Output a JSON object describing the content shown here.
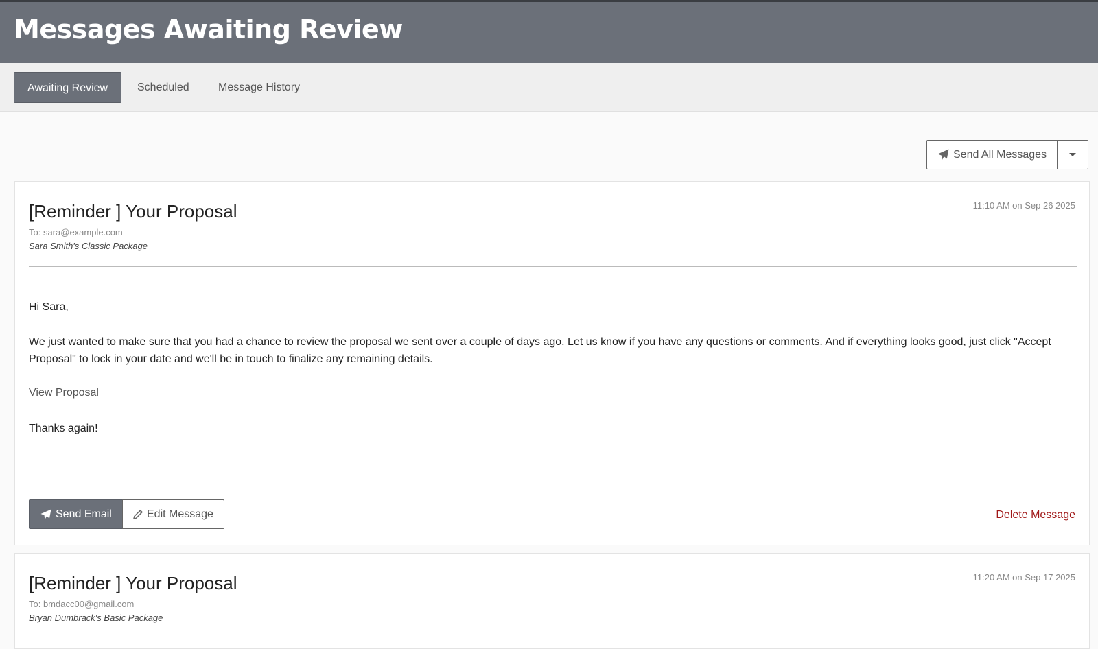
{
  "header": {
    "title": "Messages Awaiting Review"
  },
  "tabs": [
    {
      "label": "Awaiting Review",
      "active": true
    },
    {
      "label": "Scheduled",
      "active": false
    },
    {
      "label": "Message History",
      "active": false
    }
  ],
  "toolbar": {
    "send_all_label": "Send All Messages",
    "send_icon": "paper-plane-icon",
    "dropdown_icon": "caret-down-icon"
  },
  "messages": [
    {
      "subject": "[Reminder ] Your Proposal",
      "timestamp": "11:10 AM on Sep 26 2025",
      "to": "To: sara@example.com",
      "package": "Sara Smith's Classic Package",
      "greeting": "Hi Sara,",
      "body": "We just wanted to make sure that you had a chance to review the proposal we sent over a couple of days ago. Let us know if you have any questions or comments. And if everything looks good, just click \"Accept Proposal\" to lock in your date and we'll be in touch to finalize any remaining details.",
      "link_label": "View Proposal",
      "closing": "Thanks again!",
      "send_label": "Send Email",
      "edit_label": "Edit Message",
      "delete_label": "Delete Message"
    },
    {
      "subject": "[Reminder ] Your Proposal",
      "timestamp": "11:20 AM on Sep 17 2025",
      "to": "To: bmdacc00@gmail.com",
      "package": "Bryan Dumbrack's Basic Package"
    }
  ],
  "colors": {
    "header_bg": "#6b7079",
    "active_tab_bg": "#6b7079",
    "delete": "#a01818",
    "send_button_bg": "#6b7079"
  }
}
